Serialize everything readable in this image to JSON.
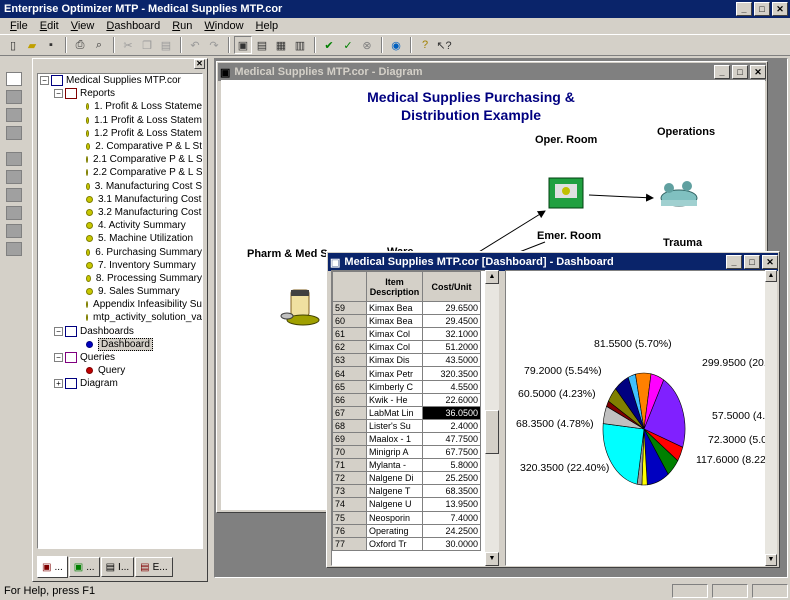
{
  "app": {
    "title": "Enterprise Optimizer MTP - Medical Supplies MTP.cor"
  },
  "menu": [
    "File",
    "Edit",
    "View",
    "Dashboard",
    "Run",
    "Window",
    "Help"
  ],
  "toolbar_icons": [
    "new-icon",
    "open-icon",
    "save-icon",
    "print-icon",
    "print-preview-icon",
    "cut-icon",
    "copy-icon",
    "paste-icon",
    "undo-icon",
    "redo-icon",
    "view-icon",
    "view-icon",
    "view-icon",
    "view-icon",
    "run-icon",
    "run-icon",
    "stop-icon",
    "web-icon",
    "help-icon",
    "context-help-icon"
  ],
  "tree": {
    "root": "Medical Supplies MTP.cor",
    "reports_label": "Reports",
    "reports": [
      "1.  Profit & Loss Stateme",
      "1.1  Profit & Loss Statem",
      "1.2  Profit & Loss Statem",
      "2.  Comparative P & L St",
      "2.1  Comparative P & L S",
      "2.2  Comparative P & L S",
      "3.  Manufacturing Cost S",
      "3.1  Manufacturing Cost",
      "3.2  Manufacturing Cost",
      "4.  Activity Summary",
      "5.  Machine Utilization",
      "6.  Purchasing Summary",
      "7.  Inventory Summary",
      "8.  Processing Summary",
      "9.  Sales Summary",
      "Appendix  Infeasibility Su",
      "mtp_activity_solution_va"
    ],
    "dashboards_label": "Dashboards",
    "dashboard_item": "Dashboard",
    "queries_label": "Queries",
    "query_item": "Query",
    "diagram_label": "Diagram"
  },
  "tabs": [
    "...",
    "...",
    "I...",
    "E..."
  ],
  "diagram_window": {
    "title": "Medical Supplies MTP.cor - Diagram",
    "heading_line1": "Medical Supplies Purchasing &",
    "heading_line2": "Distribution Example",
    "nodes": {
      "oper_room": "Oper. Room",
      "operations": "Operations",
      "emer_room": "Emer. Room",
      "trauma": "Trauma",
      "pharm": "Pharm & Med S",
      "ware": "Ware"
    }
  },
  "dashboard_window": {
    "title": "Medical Supplies MTP.cor [Dashboard] - Dashboard",
    "col_item": "Item Description",
    "col_cost": "Cost/Unit",
    "rows": [
      {
        "n": "59",
        "item": "Kimax Bea",
        "cost": "29.6500"
      },
      {
        "n": "60",
        "item": "Kimax Bea",
        "cost": "29.4500"
      },
      {
        "n": "61",
        "item": "Kimax Col",
        "cost": "32.1000"
      },
      {
        "n": "62",
        "item": "Kimax Col",
        "cost": "51.2000"
      },
      {
        "n": "63",
        "item": "Kimax Dis",
        "cost": "43.5000"
      },
      {
        "n": "64",
        "item": "Kimax Petr",
        "cost": "320.3500"
      },
      {
        "n": "65",
        "item": "Kimberly C",
        "cost": "4.5500"
      },
      {
        "n": "66",
        "item": "Kwik - He",
        "cost": "22.6000"
      },
      {
        "n": "67",
        "item": "LabMat Lin",
        "cost": "36.0500",
        "selected": true
      },
      {
        "n": "68",
        "item": "Lister's Su",
        "cost": "2.4000"
      },
      {
        "n": "69",
        "item": "Maalox - 1",
        "cost": "47.7500"
      },
      {
        "n": "70",
        "item": "Minigrip A",
        "cost": "67.7500"
      },
      {
        "n": "71",
        "item": "Mylanta -",
        "cost": "5.8000"
      },
      {
        "n": "72",
        "item": "Nalgene Di",
        "cost": "25.2500"
      },
      {
        "n": "73",
        "item": "Nalgene T",
        "cost": "68.3500"
      },
      {
        "n": "74",
        "item": "Nalgene U",
        "cost": "13.9500"
      },
      {
        "n": "75",
        "item": "Neosporin",
        "cost": "7.4000"
      },
      {
        "n": "76",
        "item": "Operating",
        "cost": "24.2500"
      },
      {
        "n": "77",
        "item": "Oxford Tr",
        "cost": "30.0000"
      }
    ]
  },
  "chart_data": {
    "type": "pie",
    "title": "",
    "slices": [
      {
        "value": 299.95,
        "label": "299.9500 (20.9",
        "color": "#8020ff"
      },
      {
        "value": 57.5,
        "label": "57.5000 (4.",
        "color": "#ff0000"
      },
      {
        "value": 72.3,
        "label": "72.3000 (5.0",
        "color": "#008000"
      },
      {
        "value": 117.6,
        "label": "117.6000 (8.22",
        "color": "#0000c0"
      },
      {
        "value": 28,
        "label": "",
        "color": "#ffff00"
      },
      {
        "value": 25,
        "label": "",
        "color": "#a0a0a0"
      },
      {
        "value": 320.35,
        "label": "320.3500 (22.40%)",
        "color": "#00ffff"
      },
      {
        "value": 68.35,
        "label": "68.3500 (4.78%)",
        "color": "#c0c0c0"
      },
      {
        "value": 22,
        "label": "",
        "color": "#800000"
      },
      {
        "value": 60.5,
        "label": "60.5000 (4.23%)",
        "color": "#808000"
      },
      {
        "value": 79.2,
        "label": "79.2000 (5.54%)",
        "color": "#000080"
      },
      {
        "value": 40,
        "label": "",
        "color": "#40c0ff"
      },
      {
        "value": 81.55,
        "label": "81.5500 (5.70%)",
        "color": "#ff8000"
      },
      {
        "value": 70,
        "label": "",
        "color": "#ff00ff"
      }
    ]
  },
  "status": {
    "text": "For Help, press F1"
  }
}
